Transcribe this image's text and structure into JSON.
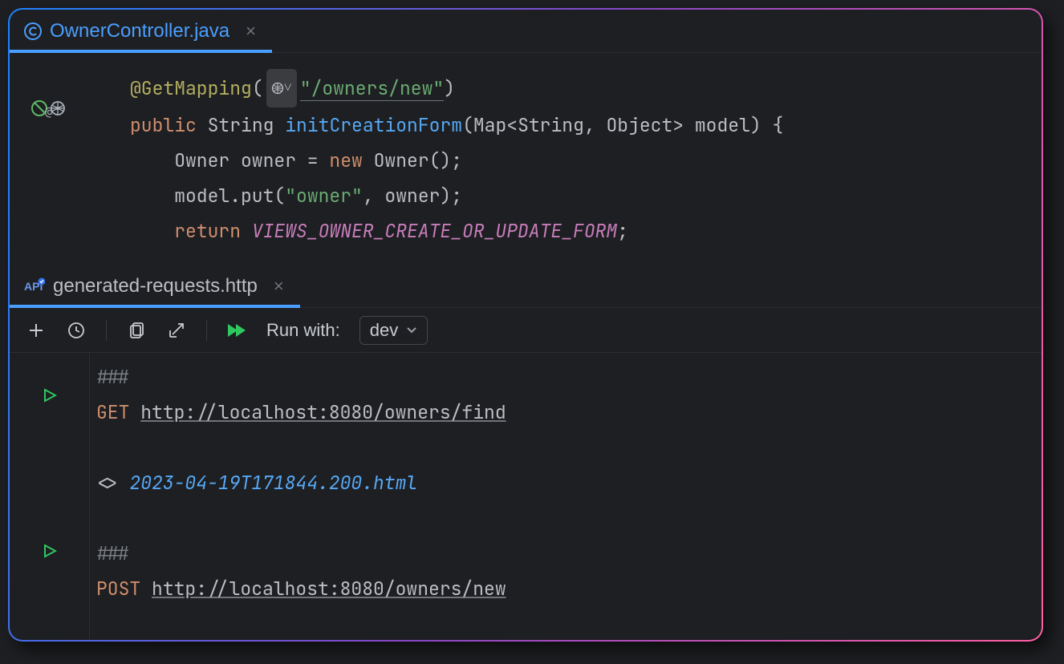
{
  "topTab": {
    "label": "OwnerController.java"
  },
  "code": {
    "annotation": "@GetMapping",
    "pillIcon": "globe-icon",
    "mappingPath": "\"/owners/new\"",
    "kwPublic": "public",
    "type": "String",
    "method": "initCreationForm",
    "params": "(Map<String, Object> model) {",
    "line2a": "Owner owner = ",
    "kwNew": "new",
    "line2b": " Owner();",
    "line3a": "model.put(",
    "ownerStr": "\"owner\"",
    "line3b": ", owner);",
    "kwReturn": "return",
    "constName": "VIEWS_OWNER_CREATE_OR_UPDATE_FORM",
    "semi": ";"
  },
  "httpTab": {
    "label": "generated-requests.http"
  },
  "toolbar": {
    "runWith": "Run with:",
    "env": "dev"
  },
  "http": {
    "hash": "###",
    "verb1": "GET",
    "url1": "http://localhost:8080/owners/find",
    "respPrefix": "<> ",
    "respFile": "2023-04-19T171844.200.html",
    "verb2": "POST",
    "url2": "http://localhost:8080/owners/new"
  }
}
